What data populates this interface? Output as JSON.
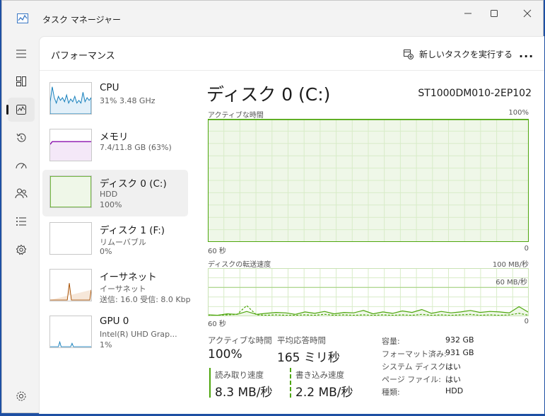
{
  "app": {
    "title": "タスク マネージャー",
    "window_buttons": [
      "minimize",
      "maximize",
      "close"
    ]
  },
  "header": {
    "page_title": "パフォーマンス",
    "run_task_label": "新しいタスクを実行する",
    "more_label": "..."
  },
  "sidebar": {
    "items": [
      "menu-icon",
      "processes-icon",
      "performance-icon",
      "history-icon",
      "startup-icon",
      "users-icon",
      "details-icon",
      "services-icon"
    ],
    "bottom": "settings-icon",
    "active_index": 2
  },
  "devices": [
    {
      "name": "CPU",
      "line2": "31%  3.48 GHz",
      "line3": "",
      "color": "#117dbb"
    },
    {
      "name": "メモリ",
      "line2": "7.4/11.8 GB (63%)",
      "line3": "",
      "color": "#8b12ae"
    },
    {
      "name": "ディスク 0 (C:)",
      "line2": "HDD",
      "line3": "100%",
      "color": "#4da60c"
    },
    {
      "name": "ディスク 1 (F:)",
      "line2": "リムーバブル",
      "line3": "0%",
      "color": "#4da60c"
    },
    {
      "name": "イーサネット",
      "line2": "イーサネット",
      "line3": "送信: 16.0  受信: 8.0 Kbp",
      "color": "#a74f01"
    },
    {
      "name": "GPU 0",
      "line2": "Intel(R) UHD Grap...",
      "line3": "1%",
      "color": "#117dbb"
    }
  ],
  "detail": {
    "title": "ディスク 0 (C:)",
    "model": "ST1000DM010-2EP102",
    "active_time_label": "アクティブな時間",
    "active_time_max": "100%",
    "x_left": "60 秒",
    "x_right": "0",
    "transfer_label": "ディスクの転送速度",
    "transfer_max": "100 MB/秒",
    "transfer_mid": "60 MB/秒",
    "x2_left": "60 秒",
    "x2_right": "0",
    "accent": "#4da60c",
    "fill": "#eff7e8"
  },
  "stats": {
    "active_label": "アクティブな時間",
    "active_value": "100%",
    "resp_label": "平均応答時間",
    "resp_value": "165 ミリ秒",
    "read_label": "読み取り速度",
    "read_value": "8.3 MB/秒",
    "write_label": "書き込み速度",
    "write_value": "2.2 MB/秒"
  },
  "properties": [
    {
      "key": "容量:",
      "value": "932 GB"
    },
    {
      "key": "フォーマット済み:",
      "value": "931 GB"
    },
    {
      "key": "システム ディスク:",
      "value": "はい"
    },
    {
      "key": "ページ ファイル:",
      "value": "はい"
    },
    {
      "key": "種類:",
      "value": "HDD"
    }
  ],
  "chart_data": [
    {
      "type": "area",
      "title": "アクティブな時間",
      "ylim": [
        0,
        100
      ],
      "y_unit": "%",
      "x_range_seconds": [
        60,
        0
      ],
      "values": [
        100,
        100,
        100,
        100,
        100,
        100,
        100,
        100,
        100,
        100,
        100,
        100,
        100,
        100,
        100,
        100,
        100,
        100,
        100,
        100,
        100,
        100,
        100,
        100,
        100,
        100,
        100,
        100,
        100,
        100,
        100
      ]
    },
    {
      "type": "line",
      "title": "ディスクの転送速度",
      "ylim": [
        0,
        100
      ],
      "y_unit": "MB/秒",
      "reference_line": 60,
      "series": [
        {
          "name": "読み取り速度",
          "style": "solid",
          "values": [
            3,
            2,
            5,
            4,
            10,
            4,
            6,
            8,
            7,
            4,
            9,
            6,
            10,
            5,
            8,
            7,
            12,
            5,
            9,
            6,
            11,
            8,
            14,
            6,
            10,
            7,
            9,
            12,
            8,
            10,
            9,
            7,
            20,
            8
          ]
        },
        {
          "name": "書き込み速度",
          "style": "dashed",
          "values": [
            2,
            2,
            3,
            4,
            22,
            3,
            2,
            3,
            2,
            2,
            3,
            2,
            4,
            2,
            3,
            2,
            3,
            2,
            3,
            2,
            3,
            2,
            4,
            2,
            3,
            2,
            3,
            4,
            2,
            3,
            2,
            3,
            6,
            2
          ]
        }
      ]
    }
  ]
}
